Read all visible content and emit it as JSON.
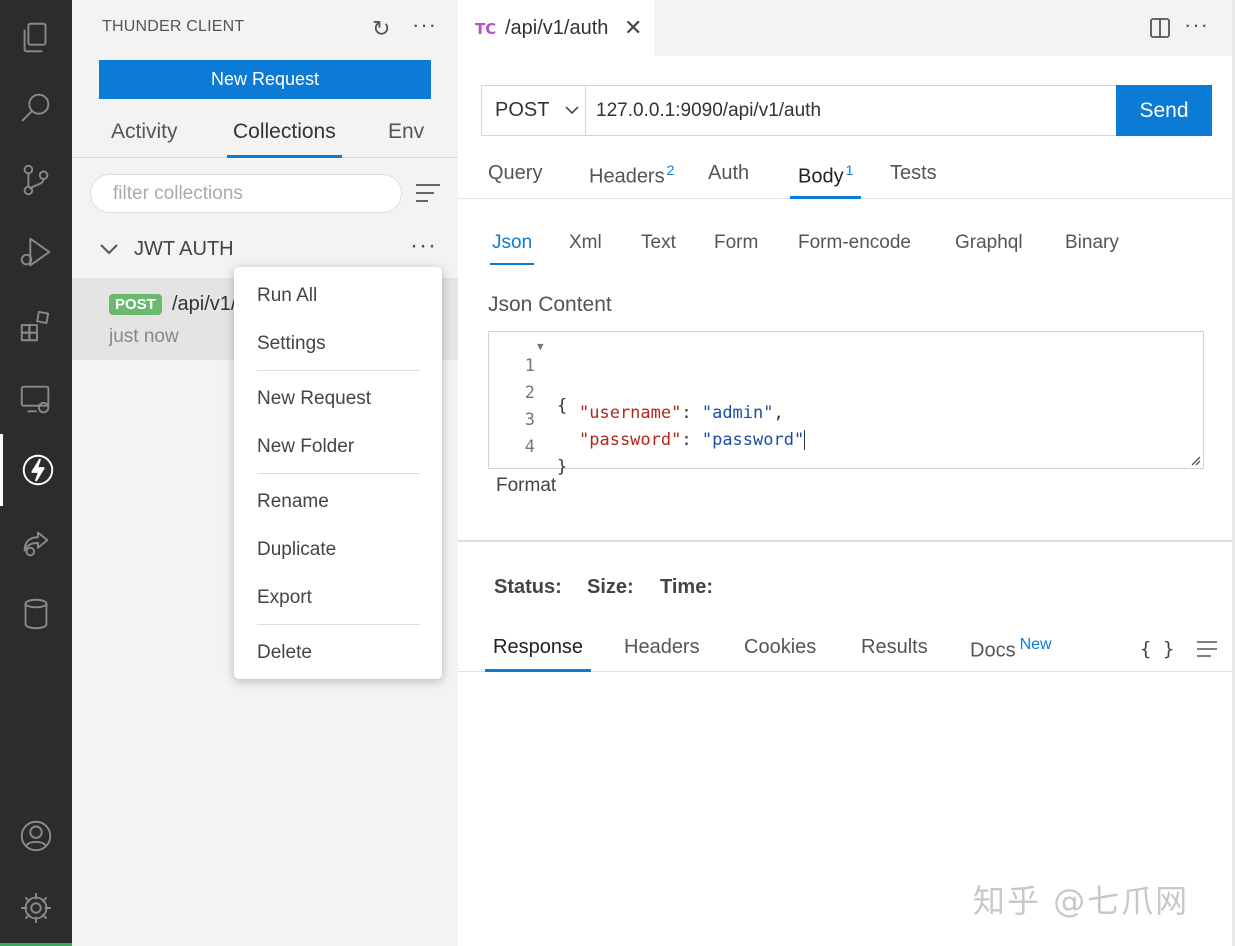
{
  "activity_bar": {
    "icons": [
      "explorer-icon",
      "search-icon",
      "source-control-icon",
      "run-debug-icon",
      "extensions-icon",
      "remote-explorer-icon",
      "thunder-client-icon",
      "live-share-icon",
      "database-icon",
      "account-icon",
      "settings-gear-icon"
    ]
  },
  "sidebar": {
    "title": "THUNDER CLIENT",
    "new_request_label": "New Request",
    "tabs": [
      {
        "label": "Activity"
      },
      {
        "label": "Collections",
        "active": true
      },
      {
        "label": "Env"
      }
    ],
    "filter_placeholder": "filter collections",
    "collection": {
      "name": "JWT AUTH",
      "requests": [
        {
          "method": "POST",
          "path": "/api/v1/auth",
          "time": "just now"
        }
      ]
    },
    "context_menu": {
      "items": [
        "Run All",
        "Settings",
        "New Request",
        "New Folder",
        "Rename",
        "Duplicate",
        "Export",
        "Delete"
      ]
    }
  },
  "editor": {
    "tab_icon_text": "TC",
    "tab_title": "/api/v1/auth",
    "method": "POST",
    "url": "127.0.0.1:9090/api/v1/auth",
    "send_label": "Send",
    "request_tabs": [
      {
        "label": "Query"
      },
      {
        "label": "Headers",
        "badge": "2"
      },
      {
        "label": "Auth"
      },
      {
        "label": "Body",
        "badge": "1",
        "active": true
      },
      {
        "label": "Tests"
      }
    ],
    "body_tabs": [
      {
        "label": "Json",
        "active": true
      },
      {
        "label": "Xml"
      },
      {
        "label": "Text"
      },
      {
        "label": "Form"
      },
      {
        "label": "Form-encode"
      },
      {
        "label": "Graphql"
      },
      {
        "label": "Binary"
      }
    ],
    "json_content_label": "Json Content",
    "code_lines": [
      {
        "n": "1",
        "text": "{"
      },
      {
        "n": "2",
        "key": "\"username\"",
        "value": "\"admin\"",
        "trail": ","
      },
      {
        "n": "3",
        "key": "\"password\"",
        "value": "\"password\"",
        "trail": ""
      },
      {
        "n": "4",
        "text": "}"
      }
    ],
    "format_label": "Format"
  },
  "response": {
    "status_label": "Status:",
    "size_label": "Size:",
    "time_label": "Time:",
    "tabs": [
      {
        "label": "Response",
        "active": true
      },
      {
        "label": "Headers"
      },
      {
        "label": "Cookies"
      },
      {
        "label": "Results"
      },
      {
        "label": "Docs",
        "badge": "New"
      }
    ],
    "braces_text": "{ }"
  },
  "watermark": "知乎 @七爪网",
  "colors": {
    "accent": "#0c7bd6",
    "activity_bar_bg": "#2c2c2c",
    "sidebar_bg": "#f3f3f3",
    "post_badge": "#6ab96f",
    "json_key": "#b3261e",
    "json_string": "#1a4fa0"
  }
}
